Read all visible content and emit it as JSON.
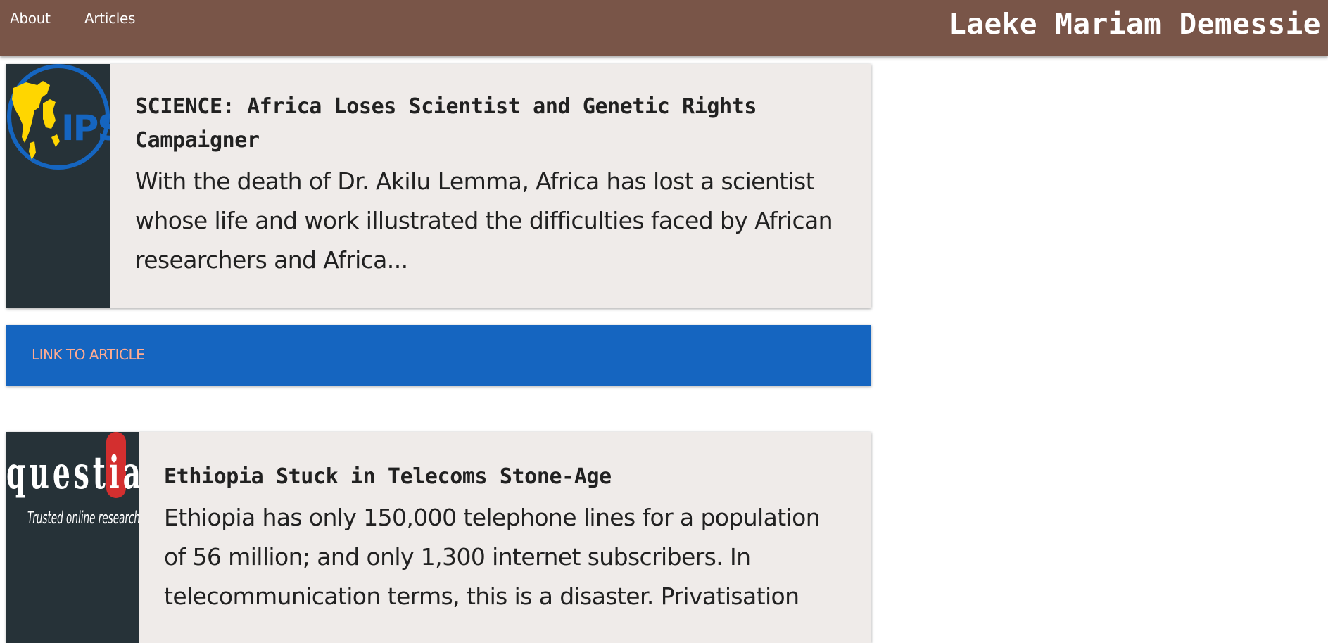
{
  "nav": {
    "about": "About",
    "articles": "Articles",
    "site_title": "Laeke Mariam Demessie"
  },
  "articles": [
    {
      "logo_text": "IPS",
      "logo_icon": "ips-logo-icon",
      "title": "SCIENCE: Africa Loses Scientist and Genetic Rights Campaigner",
      "excerpt": "With the death of Dr. Akilu Lemma, Africa has lost a scientist whose life and work illustrated the difficulties faced by African researchers and Africa...",
      "link_label": "LINK TO ARTICLE"
    },
    {
      "logo_text": "questia",
      "logo_tagline": "Trusted online research",
      "logo_icon": "questia-logo-icon",
      "title": "Ethiopia Stuck in Telecoms Stone-Age",
      "excerpt": "Ethiopia has only 150,000 telephone lines for a population of 56 million; and only 1,300 internet subscribers. In telecommunication terms, this is a disaster. Privatisation"
    }
  ],
  "colors": {
    "navbar": "#795548",
    "card_background": "#efebe9",
    "thumb_background": "#263238",
    "link_bar": "#1565c0",
    "link_text": "#ffab91",
    "ips_blue": "#1565c0",
    "ips_yellow": "#ffd600",
    "questia_red": "#d32f2f"
  }
}
